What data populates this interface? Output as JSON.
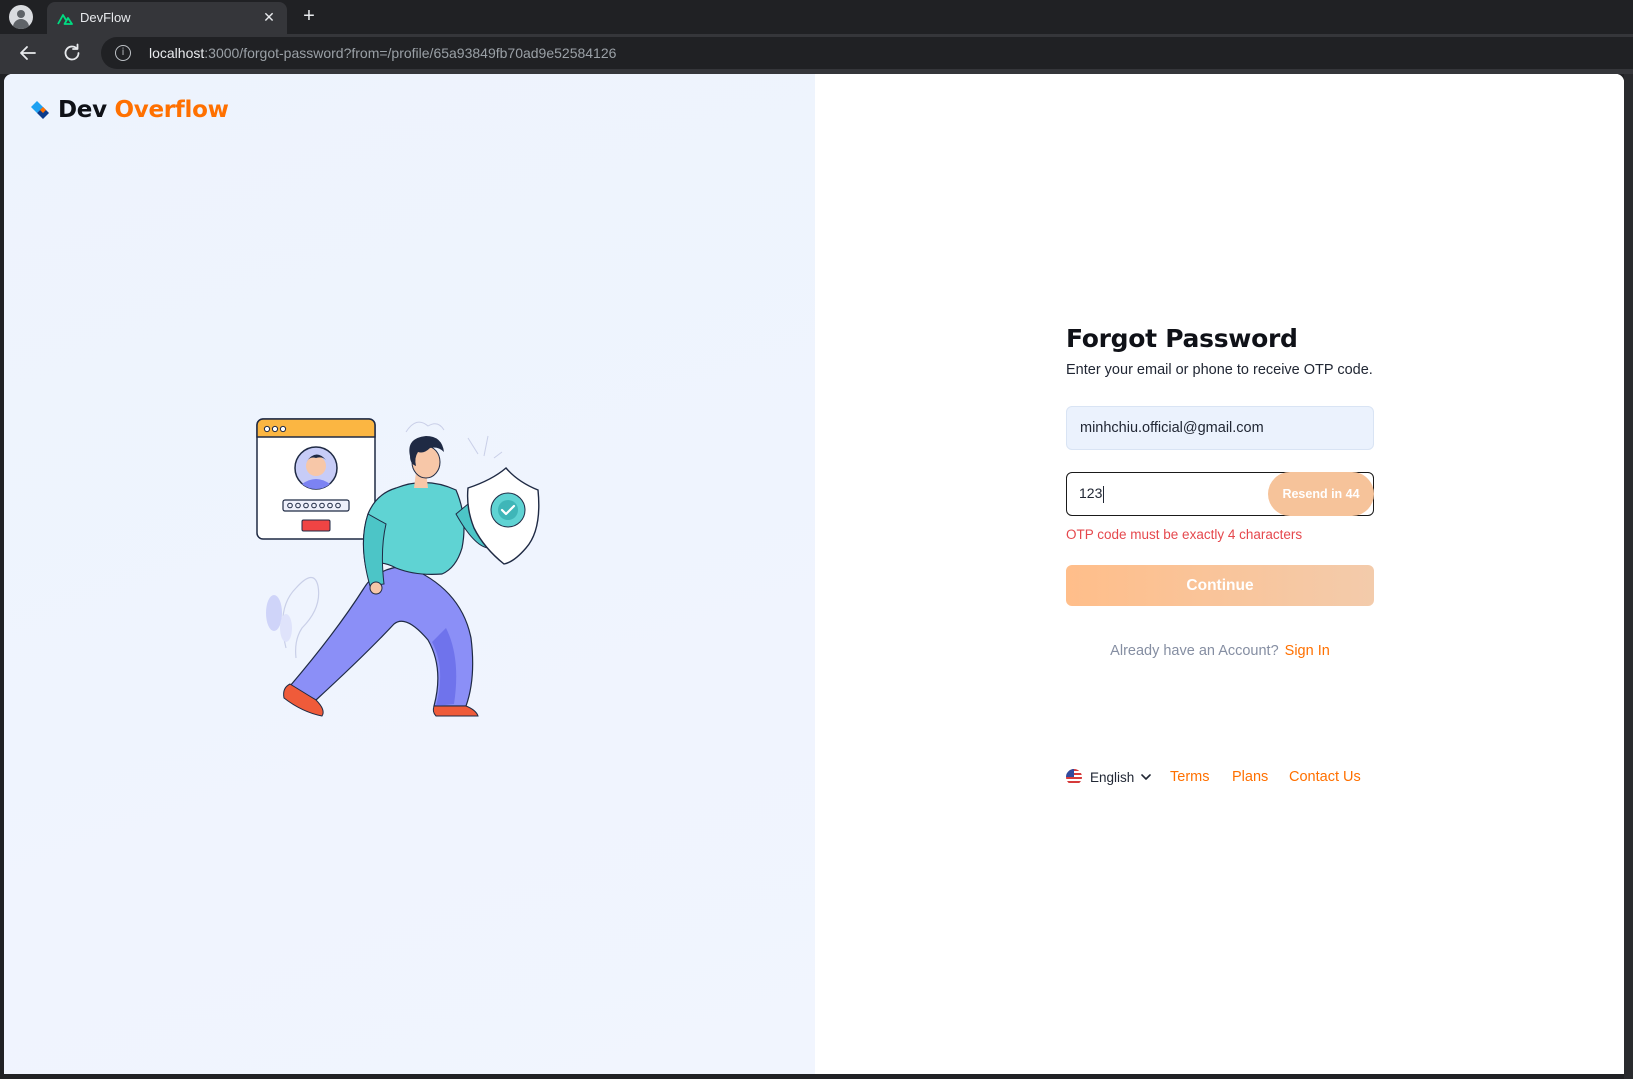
{
  "browser": {
    "tab_title": "DevFlow",
    "tab_close_glyph": "✕",
    "new_tab_glyph": "+",
    "url_host": "localhost",
    "url_rest": ":3000/forgot-password?from=/profile/65a93849fb70ad9e52584126",
    "info_glyph": "i",
    "favicon_color": "#00dc82"
  },
  "logo": {
    "part1": "Dev",
    "part2": "Overflow",
    "accent_color": "#ff7000",
    "mark_color": "#1da1f2"
  },
  "form": {
    "title": "Forgot Password",
    "subtitle": "Enter your email or phone to receive OTP code.",
    "email_value": "minhchiu.official@gmail.com",
    "otp_value": "123",
    "resend_label": "Resend in 44",
    "otp_error": "OTP code must be exactly 4 characters",
    "continue_label": "Continue",
    "signin_prompt": "Already have an Account?",
    "signin_link": "Sign In"
  },
  "footer": {
    "language": "English",
    "links": [
      "Terms",
      "Plans",
      "Contact Us"
    ]
  },
  "colors": {
    "accent": "#ff7000",
    "error": "#e5484d",
    "input_bg": "#ebf2fd",
    "left_bg": "#edf3fd"
  },
  "icons": [
    "profile-icon",
    "back-arrow-icon",
    "reload-icon",
    "info-icon",
    "logo-mark-icon",
    "us-flag-icon",
    "chevron-down-icon",
    "close-icon",
    "plus-icon"
  ]
}
